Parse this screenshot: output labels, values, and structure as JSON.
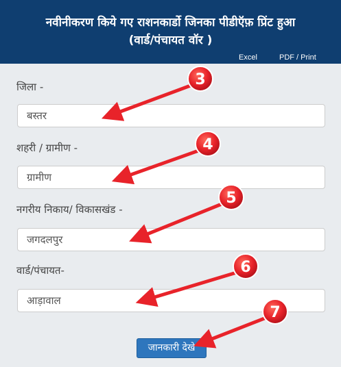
{
  "header": {
    "title_line1": "नवीनीकरण किये गए राशनकार्डो जिनका पीडीऍफ़ प्रिंट हुआ",
    "title_line2": "(वार्ड/पंचायत वॉर )",
    "link_excel": "Excel",
    "link_pdf": "PDF / Print"
  },
  "form": {
    "district": {
      "label": "जिला -",
      "value": "बस्तर"
    },
    "area_type": {
      "label": "शहरी / ग्रामीण -",
      "value": "ग्रामीण"
    },
    "block": {
      "label": "नगरीय निकाय/ विकासखंड -",
      "value": "जगदलपुर"
    },
    "ward": {
      "label": "वार्ड/पंचायत-",
      "value": "आड़ावाल"
    },
    "submit_label": "जानकारी देखे"
  },
  "annotations": [
    {
      "number": "3"
    },
    {
      "number": "4"
    },
    {
      "number": "5"
    },
    {
      "number": "6"
    },
    {
      "number": "7"
    }
  ],
  "colors": {
    "header_bg": "#0f3e70",
    "page_bg": "#e9ecef",
    "button_bg": "#2e76bd",
    "annotation_red": "#e8232a"
  }
}
